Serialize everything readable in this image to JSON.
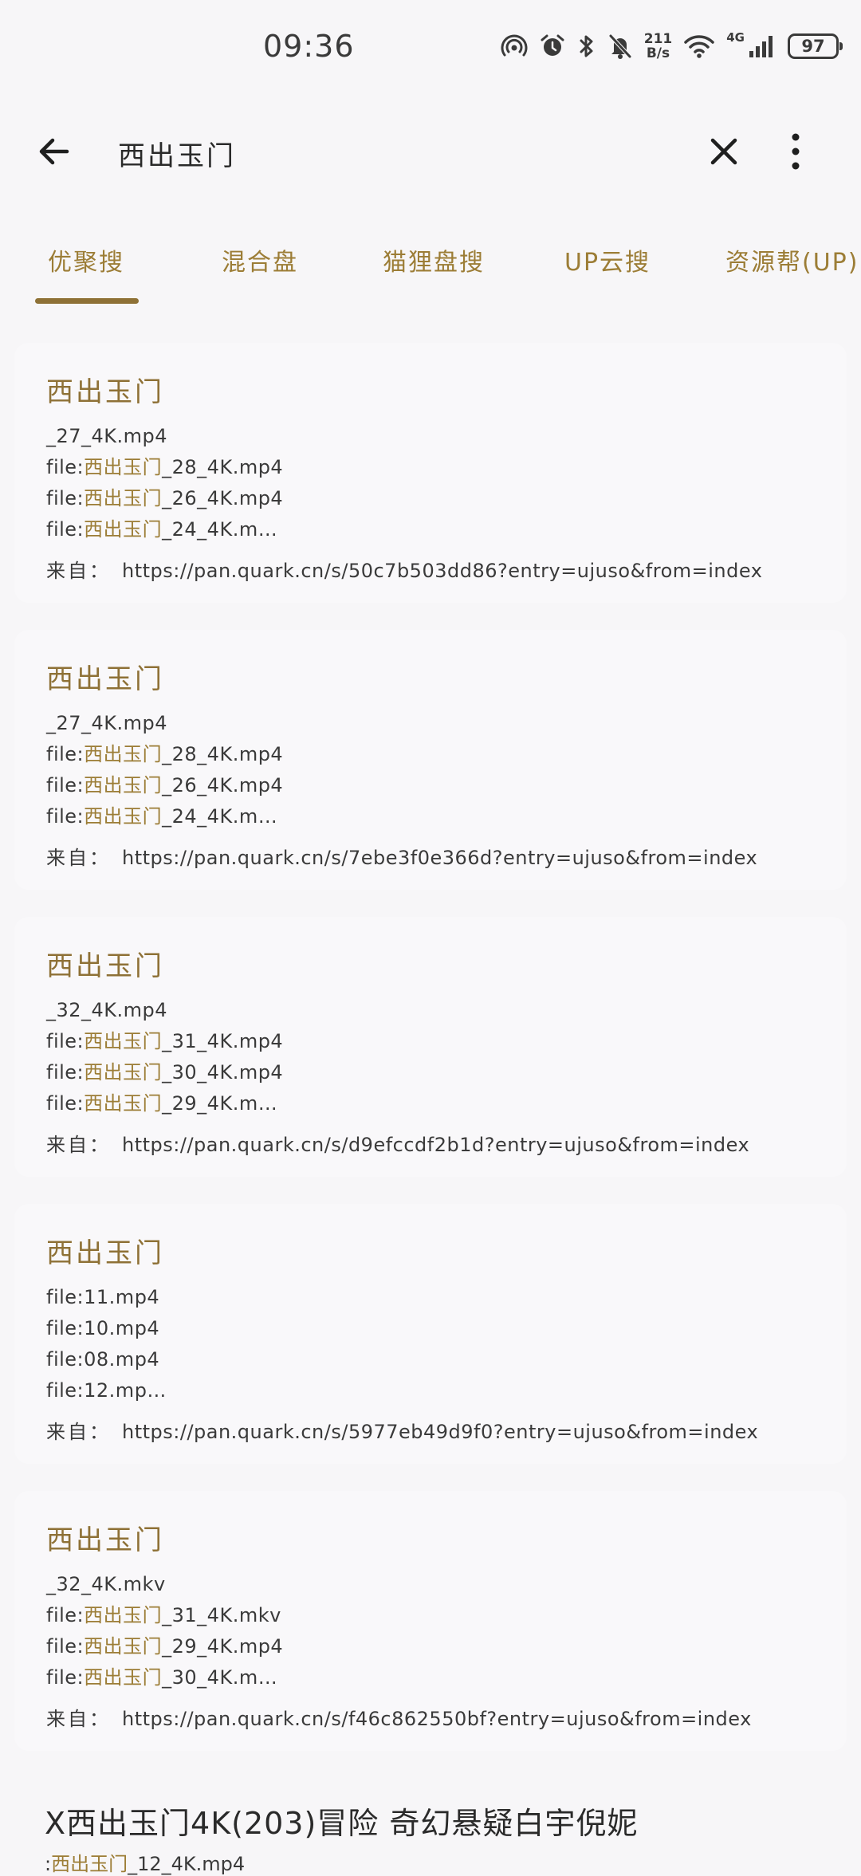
{
  "status": {
    "time": "09:36",
    "net_speed_value": "211",
    "net_speed_unit": "B/s",
    "network_type": "4G",
    "battery": "97"
  },
  "search": {
    "query": "西出玉门"
  },
  "tabs": [
    {
      "label": "优聚搜",
      "active": true
    },
    {
      "label": "混合盘",
      "active": false
    },
    {
      "label": "猫狸盘搜",
      "active": false
    },
    {
      "label": "UP云搜",
      "active": false
    },
    {
      "label": "资源帮(UP)",
      "active": false
    }
  ],
  "source_label": "来自：",
  "results": [
    {
      "title": "西出玉门",
      "lines": [
        {
          "prefix": "",
          "hl": "",
          "rest": "_27_4K.mp4"
        },
        {
          "prefix": "file:",
          "hl": "西出玉门",
          "rest": "_28_4K.mp4"
        },
        {
          "prefix": "file:",
          "hl": "西出玉门",
          "rest": "_26_4K.mp4"
        },
        {
          "prefix": "file:",
          "hl": "西出玉门",
          "rest": "_24_4K.m…"
        }
      ],
      "url": "https://pan.quark.cn/s/50c7b503dd86?entry=ujuso&from=index"
    },
    {
      "title": "西出玉门",
      "lines": [
        {
          "prefix": "",
          "hl": "",
          "rest": "_27_4K.mp4"
        },
        {
          "prefix": "file:",
          "hl": "西出玉门",
          "rest": "_28_4K.mp4"
        },
        {
          "prefix": "file:",
          "hl": "西出玉门",
          "rest": "_26_4K.mp4"
        },
        {
          "prefix": "file:",
          "hl": "西出玉门",
          "rest": "_24_4K.m…"
        }
      ],
      "url": "https://pan.quark.cn/s/7ebe3f0e366d?entry=ujuso&from=index"
    },
    {
      "title": "西出玉门",
      "lines": [
        {
          "prefix": "",
          "hl": "",
          "rest": "_32_4K.mp4"
        },
        {
          "prefix": "file:",
          "hl": "西出玉门",
          "rest": "_31_4K.mp4"
        },
        {
          "prefix": "file:",
          "hl": "西出玉门",
          "rest": "_30_4K.mp4"
        },
        {
          "prefix": "file:",
          "hl": "西出玉门",
          "rest": "_29_4K.m…"
        }
      ],
      "url": "https://pan.quark.cn/s/d9efccdf2b1d?entry=ujuso&from=index"
    },
    {
      "title": "西出玉门",
      "lines": [
        {
          "prefix": "file:",
          "hl": "",
          "rest": "11.mp4"
        },
        {
          "prefix": "file:",
          "hl": "",
          "rest": "10.mp4"
        },
        {
          "prefix": "file:",
          "hl": "",
          "rest": "08.mp4"
        },
        {
          "prefix": "file:",
          "hl": "",
          "rest": "12.mp…"
        }
      ],
      "url": "https://pan.quark.cn/s/5977eb49d9f0?entry=ujuso&from=index"
    },
    {
      "title": "西出玉门",
      "lines": [
        {
          "prefix": "",
          "hl": "",
          "rest": "_32_4K.mkv"
        },
        {
          "prefix": "file:",
          "hl": "西出玉门",
          "rest": "_31_4K.mkv"
        },
        {
          "prefix": "file:",
          "hl": "西出玉门",
          "rest": "_29_4K.mp4"
        },
        {
          "prefix": "file:",
          "hl": "西出玉门",
          "rest": "_30_4K.m…"
        }
      ],
      "url": "https://pan.quark.cn/s/f46c862550bf?entry=ujuso&from=index"
    }
  ],
  "partial_result": {
    "title": "X西出玉门4K(203)冒险 奇幻悬疑白宇倪妮",
    "line_prefix": ":",
    "line_hl": "西出玉门",
    "line_rest": "_12_4K.mp4"
  }
}
